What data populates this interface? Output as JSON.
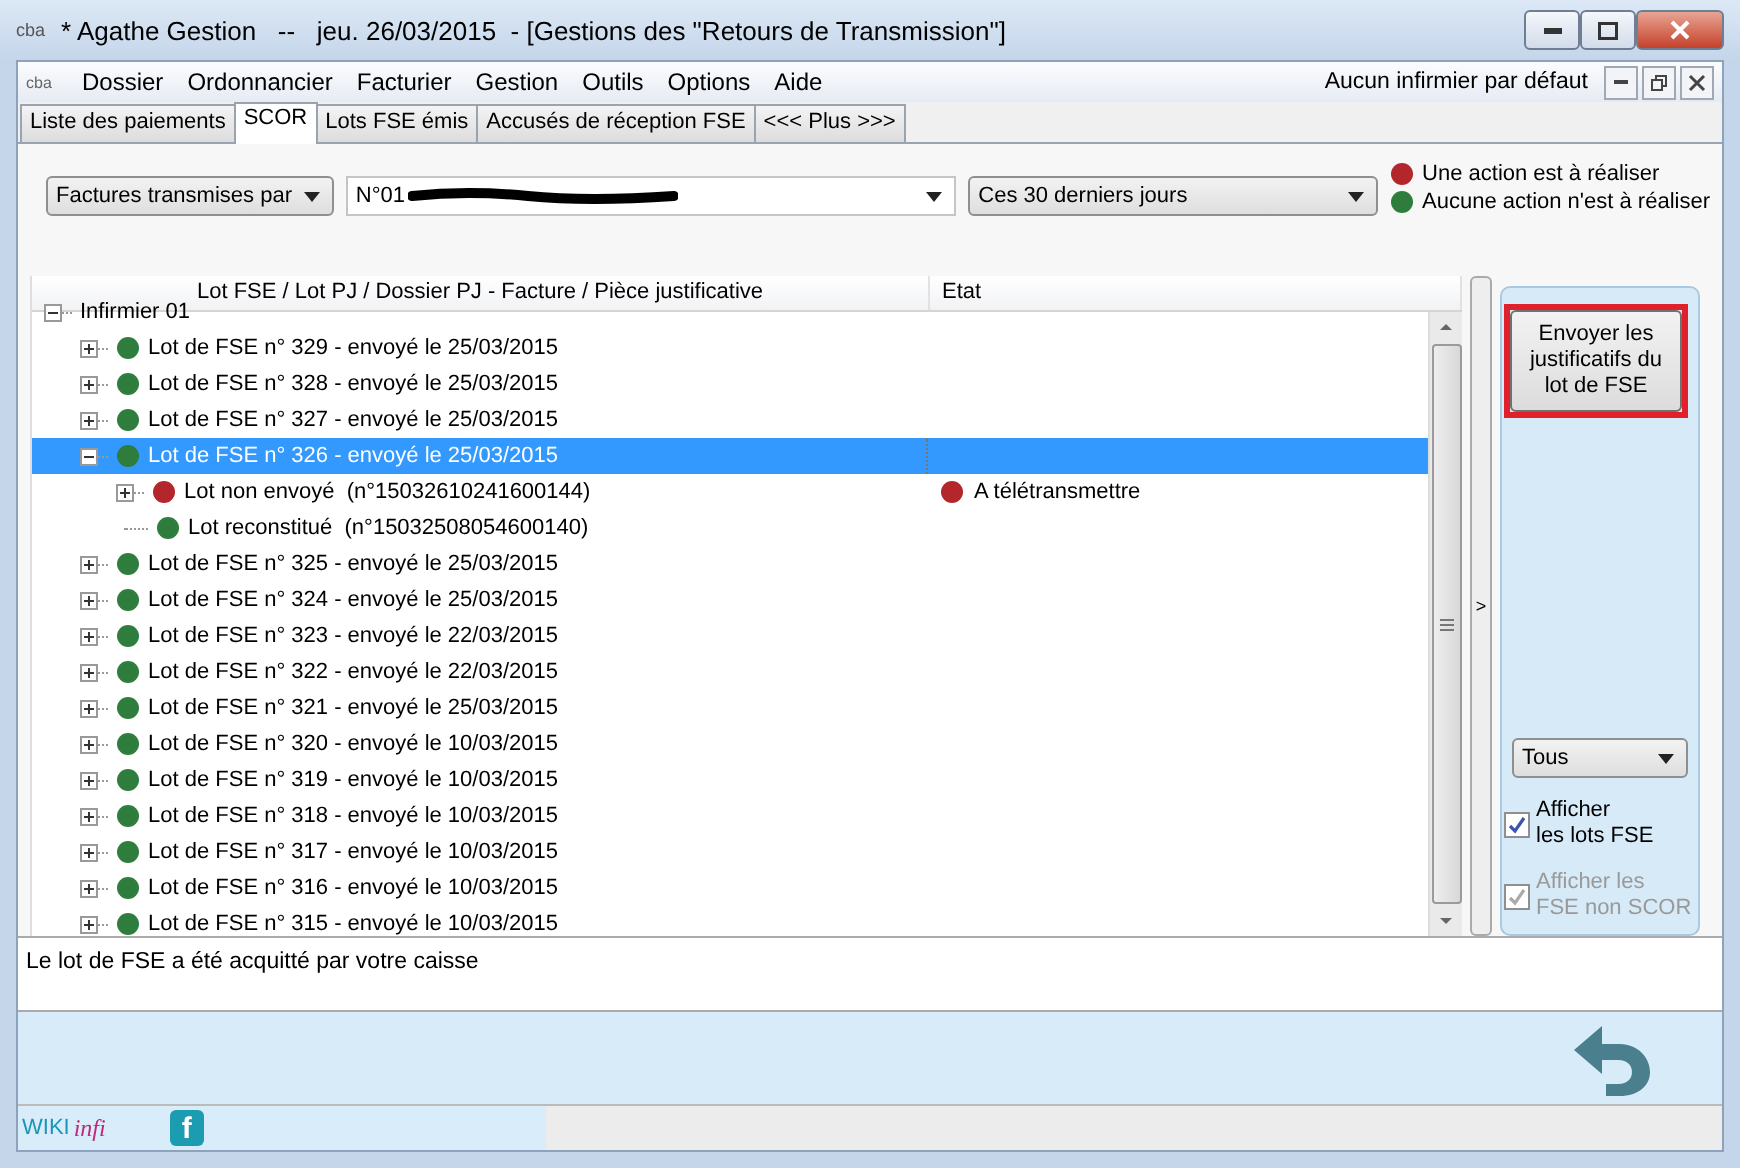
{
  "window": {
    "app_icon": "cba",
    "title": "* Agathe Gestion   --   jeu. 26/03/2015  - [Gestions des \"Retours de Transmission\"]"
  },
  "menubar": {
    "app_icon": "cba",
    "items": [
      {
        "label": "Dossier"
      },
      {
        "label": "Ordonnancier"
      },
      {
        "label": "Facturier"
      },
      {
        "label": "Gestion"
      },
      {
        "label": "Outils"
      },
      {
        "label": "Options"
      },
      {
        "label": "Aide"
      }
    ],
    "right_text": "Aucun infirmier par défaut"
  },
  "tabs": [
    {
      "label": "Liste des paiements",
      "selected": false
    },
    {
      "label": "SCOR",
      "selected": true
    },
    {
      "label": "Lots FSE émis",
      "selected": false
    },
    {
      "label": "Accusés de réception FSE",
      "selected": false
    },
    {
      "label": "<<< Plus >>>",
      "selected": false
    }
  ],
  "filters": {
    "type_select": "Factures transmises par",
    "person_select": "N°01",
    "period_select": "Ces 30 derniers jours"
  },
  "legend": [
    {
      "label": "Une action est à réaliser",
      "color": "#b3262b"
    },
    {
      "label": "Aucune action n'est à réaliser",
      "color": "#2f7d3c"
    }
  ],
  "tree": {
    "columns": [
      "Lot FSE / Lot PJ / Dossier PJ - Facture / Pièce justificative",
      "Etat"
    ],
    "nodes": [
      {
        "label": "Infirmier 01",
        "kind": "root",
        "expanded": true,
        "selected": false,
        "children": [
          {
            "label": "Lot de FSE n° 329 - envoyé le 25/03/2015",
            "kind": "branch",
            "color": "#2f7d3c",
            "expanded": false,
            "selected": false
          },
          {
            "label": "Lot de FSE n° 328 - envoyé le 25/03/2015",
            "kind": "branch",
            "color": "#2f7d3c",
            "expanded": false,
            "selected": false
          },
          {
            "label": "Lot de FSE n° 327 - envoyé le 25/03/2015",
            "kind": "branch",
            "color": "#2f7d3c",
            "expanded": false,
            "selected": false
          },
          {
            "label": "Lot de FSE n° 326 - envoyé le 25/03/2015",
            "kind": "branch",
            "color": "#2f7d3c",
            "expanded": true,
            "selected": true,
            "children": [
              {
                "label": "Lot non envoyé  (n°15032610241600144)",
                "kind": "branch",
                "color": "#b3262b",
                "expanded": false,
                "selected": false,
                "etat": {
                  "label": "A télétransmettre",
                  "color": "#b3262b"
                }
              },
              {
                "label": "Lot reconstitué  (n°15032508054600140)",
                "kind": "leaf",
                "color": "#2f7d3c",
                "selected": false
              }
            ]
          },
          {
            "label": "Lot de FSE n° 325 - envoyé le 25/03/2015",
            "kind": "branch",
            "color": "#2f7d3c",
            "expanded": false,
            "selected": false
          },
          {
            "label": "Lot de FSE n° 324 - envoyé le 25/03/2015",
            "kind": "branch",
            "color": "#2f7d3c",
            "expanded": false,
            "selected": false
          },
          {
            "label": "Lot de FSE n° 323 - envoyé le 22/03/2015",
            "kind": "branch",
            "color": "#2f7d3c",
            "expanded": false,
            "selected": false
          },
          {
            "label": "Lot de FSE n° 322 - envoyé le 22/03/2015",
            "kind": "branch",
            "color": "#2f7d3c",
            "expanded": false,
            "selected": false
          },
          {
            "label": "Lot de FSE n° 321 - envoyé le 25/03/2015",
            "kind": "branch",
            "color": "#2f7d3c",
            "expanded": false,
            "selected": false
          },
          {
            "label": "Lot de FSE n° 320 - envoyé le 10/03/2015",
            "kind": "branch",
            "color": "#2f7d3c",
            "expanded": false,
            "selected": false
          },
          {
            "label": "Lot de FSE n° 319 - envoyé le 10/03/2015",
            "kind": "branch",
            "color": "#2f7d3c",
            "expanded": false,
            "selected": false
          },
          {
            "label": "Lot de FSE n° 318 - envoyé le 10/03/2015",
            "kind": "branch",
            "color": "#2f7d3c",
            "expanded": false,
            "selected": false
          },
          {
            "label": "Lot de FSE n° 317 - envoyé le 10/03/2015",
            "kind": "branch",
            "color": "#2f7d3c",
            "expanded": false,
            "selected": false
          },
          {
            "label": "Lot de FSE n° 316 - envoyé le 10/03/2015",
            "kind": "branch",
            "color": "#2f7d3c",
            "expanded": false,
            "selected": false
          },
          {
            "label": "Lot de FSE n° 315 - envoyé le 10/03/2015",
            "kind": "branch",
            "color": "#2f7d3c",
            "expanded": false,
            "selected": false
          }
        ]
      }
    ]
  },
  "collapse_glyph": ">",
  "side_panel": {
    "button": {
      "label": "Envoyer les justificatifs du lot de FSE",
      "highlighted": true
    },
    "filter_select": "Tous",
    "checkboxes": [
      {
        "label": "Afficher\nles lots FSE",
        "checked": true,
        "disabled": false
      },
      {
        "label": "Afficher les\nFSE non SCOR",
        "checked": true,
        "disabled": true
      }
    ]
  },
  "message": "Le lot de FSE a été acquitté par votre caisse",
  "footer": {
    "brand": "WIKI",
    "brand_suffix": "infi",
    "social_glyph": "f"
  }
}
